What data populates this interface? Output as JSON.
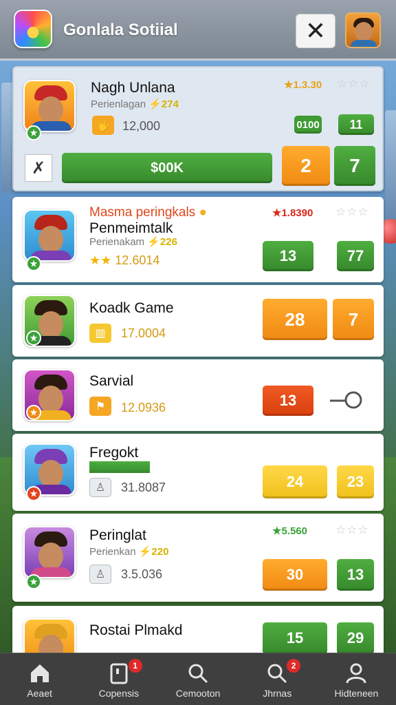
{
  "header": {
    "title": "Gonlala Sotiial",
    "close_icon": "close-icon",
    "avatar_icon": "profile-avatar"
  },
  "featured": {
    "name": "Nagh Unlana",
    "subtitle_prefix": "Perienlagan",
    "subtitle_value": "274",
    "score": "12,000",
    "rating": "1.3.30",
    "rating_color": "#e8a21a",
    "value_pill": "0100",
    "pill_right": "11",
    "action_label": "$00K",
    "btn_orange": "2",
    "btn_green": "7"
  },
  "rows": [
    {
      "title_red": "Masma peringkals",
      "name": "Penmeimtalk",
      "subtitle_prefix": "Perienakam",
      "subtitle_value": "226",
      "score": "12.6014",
      "rating": "1.8390",
      "rating_color": "#d8281c",
      "pill_a": "13",
      "pill_b": "77"
    },
    {
      "name": "Koadk Game",
      "score": "17.0004",
      "pill_a": "28",
      "pill_b": "7"
    },
    {
      "name": "Sarvial",
      "score": "12.0936",
      "pill_a": "13"
    },
    {
      "name": "Fregokt",
      "subtitle": "Penmrakamk",
      "score": "31.8087",
      "pill_a": "24",
      "pill_b": "23"
    },
    {
      "name": "Peringlat",
      "subtitle_prefix": "Perienkan",
      "subtitle_value": "220",
      "score": "3.5.036",
      "rating": "5.560",
      "rating_color": "#3aa23a",
      "pill_a": "30",
      "pill_b": "13"
    },
    {
      "name": "Rostai Plmakd",
      "pill_a": "15",
      "pill_b": "29"
    }
  ],
  "tabbar": [
    {
      "label": "Aeaet",
      "icon": "home-icon"
    },
    {
      "label": "Copensis",
      "icon": "cards-icon",
      "badge": "1"
    },
    {
      "label": "Cemooton",
      "icon": "search-icon"
    },
    {
      "label": "Jhrnas",
      "icon": "chat-search-icon",
      "badge": "2"
    },
    {
      "label": "Hidteneen",
      "icon": "profile-icon"
    }
  ],
  "colors": {
    "green": "#3f9a33",
    "orange": "#f59a1d",
    "red_orange": "#e54a17",
    "yellow": "#f5c82a",
    "tabbar": "#3f3f3f"
  }
}
